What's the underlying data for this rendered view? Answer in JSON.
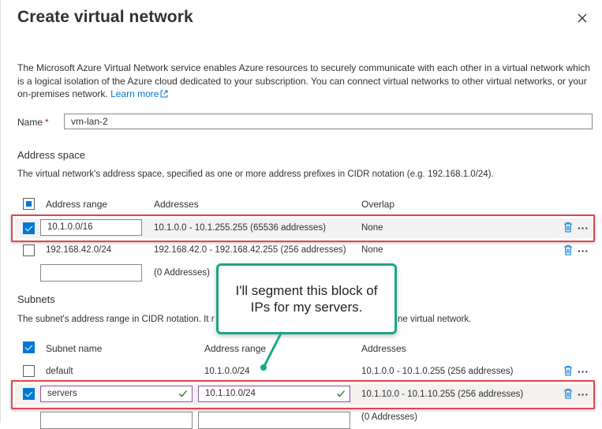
{
  "header": {
    "title": "Create virtual network"
  },
  "intro": {
    "text": "The Microsoft Azure Virtual Network service enables Azure resources to securely communicate with each other in a virtual network which is a logical isolation of the Azure cloud dedicated to your subscription. You can connect virtual networks to other virtual networks, or your on-premises network.",
    "link": "Learn more"
  },
  "name_field": {
    "label": "Name",
    "required": "*",
    "value": "vm-lan-2"
  },
  "address_space": {
    "heading": "Address space",
    "description": "The virtual network's address space, specified as one or more address prefixes in CIDR notation (e.g. 192.168.1.0/24).",
    "columns": {
      "range": "Address range",
      "addresses": "Addresses",
      "overlap": "Overlap"
    },
    "rows": [
      {
        "range": "10.1.0.0/16",
        "addresses": "10.1.0.0 - 10.1.255.255 (65536 addresses)",
        "overlap": "None",
        "checked": true
      },
      {
        "range": "192.168.42.0/24",
        "addresses": "192.168.42.0 - 192.168.42.255 (256 addresses)",
        "overlap": "None",
        "checked": false
      }
    ],
    "new_row": {
      "range": "",
      "addresses": "(0 Addresses)"
    }
  },
  "subnets": {
    "heading": "Subnets",
    "description_start": "The subnet's address range in CIDR notation. It r",
    "description_end": "ne virtual network.",
    "columns": {
      "name": "Subnet name",
      "range": "Address range",
      "addresses": "Addresses"
    },
    "rows": [
      {
        "name": "default",
        "range": "10.1.0.0/24",
        "addresses": "10.1.0.0 - 10.1.0.255 (256 addresses)",
        "checked": false
      },
      {
        "name": "servers",
        "range": "10.1.10.0/24",
        "addresses": "10.1.10.0 - 10.1.10.255 (256 addresses)",
        "checked": true
      }
    ],
    "partial_row": "(0 Addresses)"
  },
  "annotation": {
    "text": "I'll segment this block of IPs for my servers."
  },
  "colors": {
    "accent": "#0078d4",
    "highlight_border": "#e0474c",
    "callout_border": "#1aa784",
    "valid_border": "#8a56a8"
  },
  "icons": [
    "close-icon",
    "external-link-icon",
    "delete-icon",
    "more-icon",
    "checkmark-icon"
  ]
}
